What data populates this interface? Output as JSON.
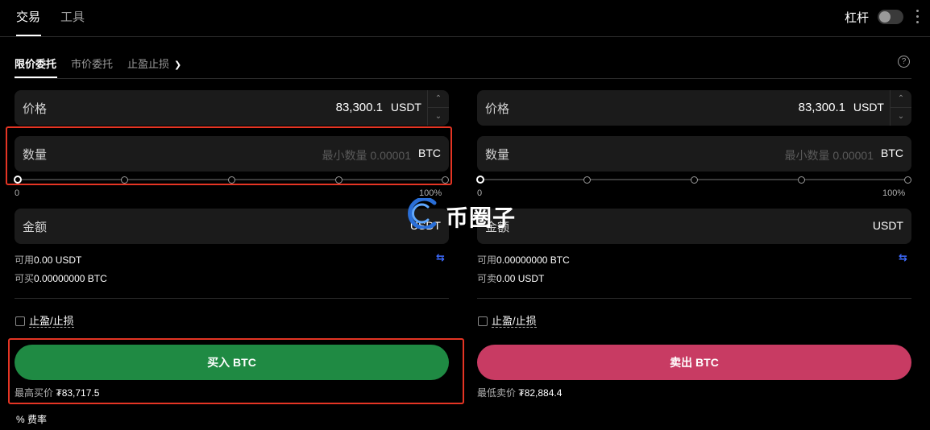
{
  "top_tabs": [
    "交易",
    "工具"
  ],
  "leverage_label": "杠杆",
  "order_tabs": [
    "限价委托",
    "市价委托",
    "止盈止损"
  ],
  "buy": {
    "price_label": "价格",
    "price_value": "83,300.1",
    "price_unit": "USDT",
    "qty_label": "数量",
    "qty_placeholder": "最小数量 0.00001",
    "qty_unit": "BTC",
    "slider_min": "0",
    "slider_max": "100%",
    "amount_label": "金额",
    "amount_unit": "USDT",
    "avail_label": "可用",
    "avail_value": "0.00 USDT",
    "can_label": "可买",
    "can_value": "0.00000000 BTC",
    "tpsl_label": "止盈/止损",
    "button_label": "买入 BTC",
    "best_label": "最高买价",
    "best_value": "₮83,717.5"
  },
  "sell": {
    "price_label": "价格",
    "price_value": "83,300.1",
    "price_unit": "USDT",
    "qty_label": "数量",
    "qty_placeholder": "最小数量 0.00001",
    "qty_unit": "BTC",
    "slider_min": "0",
    "slider_max": "100%",
    "amount_label": "金额",
    "amount_unit": "USDT",
    "avail_label": "可用",
    "avail_value": "0.00000000 BTC",
    "can_label": "可卖",
    "can_value": "0.00 USDT",
    "tpsl_label": "止盈/止损",
    "button_label": "卖出 BTC",
    "best_label": "最低卖价",
    "best_value": "₮82,884.4"
  },
  "fee_label": "% 费率",
  "watermark_text": "币圈子",
  "colors": {
    "buy": "#1f8a43",
    "sell": "#c83b63",
    "highlight": "#e53524",
    "swap_icon": "#3d6bff"
  },
  "icons": [
    "chevron-down-icon",
    "help-icon",
    "swap-icon",
    "kebab-menu-icon"
  ]
}
